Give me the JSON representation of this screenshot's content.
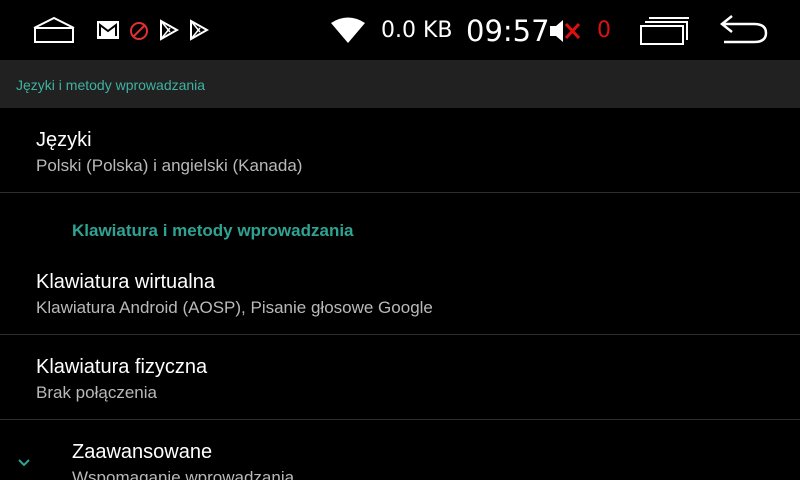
{
  "status_bar": {
    "net_speed": "0.0 KB",
    "clock": "09:57",
    "muted_count": "0",
    "icons": [
      "home-icon",
      "gmail-icon",
      "block-icon",
      "play-store-icon",
      "play-store-icon",
      "wifi-icon",
      "volume-mute-icon",
      "recent-apps-icon",
      "back-icon"
    ]
  },
  "header": {
    "title": "Języki i metody wprowadzania"
  },
  "items": [
    {
      "title": "Języki",
      "subtitle": "Polski (Polska) i angielski (Kanada)"
    },
    {
      "section": "Klawiatura i metody wprowadzania"
    },
    {
      "title": "Klawiatura wirtualna",
      "subtitle": "Klawiatura Android (AOSP), Pisanie głosowe Google"
    },
    {
      "title": "Klawiatura fizyczna",
      "subtitle": "Brak połączenia"
    },
    {
      "title": "Zaawansowane",
      "subtitle": "Wspomaganie wprowadzania"
    }
  ],
  "colors": {
    "accent": "#2fa393",
    "mute_red": "#e01010",
    "background": "#000000",
    "title_bar": "#212121"
  }
}
